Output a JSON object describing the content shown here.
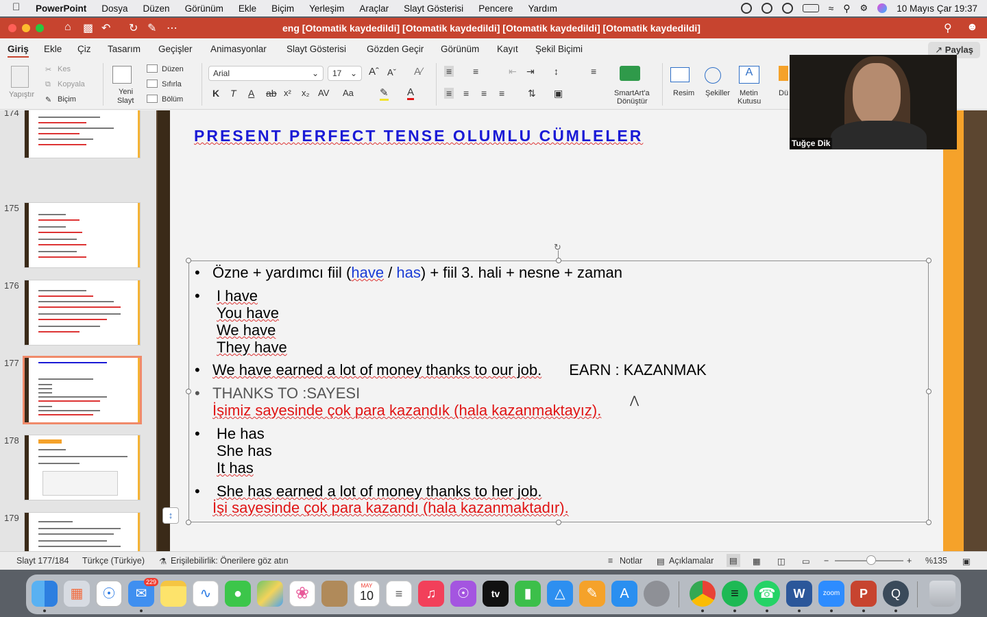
{
  "menubar": {
    "app_name": "PowerPoint",
    "items": [
      "Dosya",
      "Düzen",
      "Görünüm",
      "Ekle",
      "Biçim",
      "Yerleşim",
      "Araçlar",
      "Slayt Gösterisi",
      "Pencere",
      "Yardım"
    ],
    "datetime": "10 Mayıs Çar  19:37"
  },
  "window": {
    "title": "eng [Otomatik kaydedildi] [Otomatik kaydedildi] [Otomatik kaydedildi] [Otomatik kaydedildi]",
    "accent": "#c7442f"
  },
  "ribbon_tabs": [
    "Giriş",
    "Ekle",
    "Çiz",
    "Tasarım",
    "Geçişler",
    "Animasyonlar",
    "Slayt Gösterisi",
    "Gözden Geçir",
    "Görünüm",
    "Kayıt",
    "Şekil Biçimi"
  ],
  "share_label": "Paylaş",
  "ribbon": {
    "paste": "Yapıştır",
    "cut": "Kes",
    "copy": "Kopyala",
    "format": "Biçim",
    "new_slide_1": "Yeni",
    "new_slide_2": "Slayt",
    "layout": "Düzen",
    "reset": "Sıfırla",
    "section": "Bölüm",
    "font_name": "Arial",
    "font_size": "17",
    "smartart_1": "SmartArt'a",
    "smartart_2": "Dönüştür",
    "picture": "Resim",
    "shapes": "Şekiller",
    "textbox_1": "Metin",
    "textbox_2": "Kutusu",
    "truncated": "Dü"
  },
  "thumbnails": [
    {
      "num": "174"
    },
    {
      "num": "175"
    },
    {
      "num": "176"
    },
    {
      "num": "177",
      "active": true
    },
    {
      "num": "178"
    },
    {
      "num": "179"
    }
  ],
  "slide": {
    "title": "PRESENT PERFECT TENSE OLUMLU CÜMLELER",
    "bullets": {
      "b1_pre": "Özne + yardımcı fiil (",
      "b1_have": "have",
      "b1_slash": " / ",
      "b1_has": "has",
      "b1_post": ") + fiil 3. hali + nesne + zaman",
      "i_have": "I have",
      "you_have": "You have",
      "we_have": "We have",
      "they_have": "They have",
      "earned": "We have earned a lot of money thanks to our job.",
      "earn": "EARN : KAZANMAK",
      "thanks_to": "THANKS TO :SAYESI",
      "tr1": "İşimiz sayesinde çok para kazandık (hala kazanmaktayız).",
      "he_has": "He has",
      "she_has": "She has",
      "it_has": "It has",
      "she_earned": "She has earned a lot of money thanks to her job.",
      "tr2": "İşi sayesinde çok para kazandı (hala kazanmaktadır)."
    }
  },
  "video": {
    "name": "Tuğçe Dik"
  },
  "statusbar": {
    "slide_count": "Slayt 177/184",
    "language": "Türkçe (Türkiye)",
    "accessibility": "Erişilebilirlik: Önerilere göz atın",
    "notes": "Notlar",
    "comments": "Açıklamalar",
    "zoom": "%135"
  },
  "dock": {
    "mail_badge": "229",
    "calendar_month": "MAY",
    "calendar_day": "10",
    "appletv": "tv",
    "zoom": "zoom"
  }
}
